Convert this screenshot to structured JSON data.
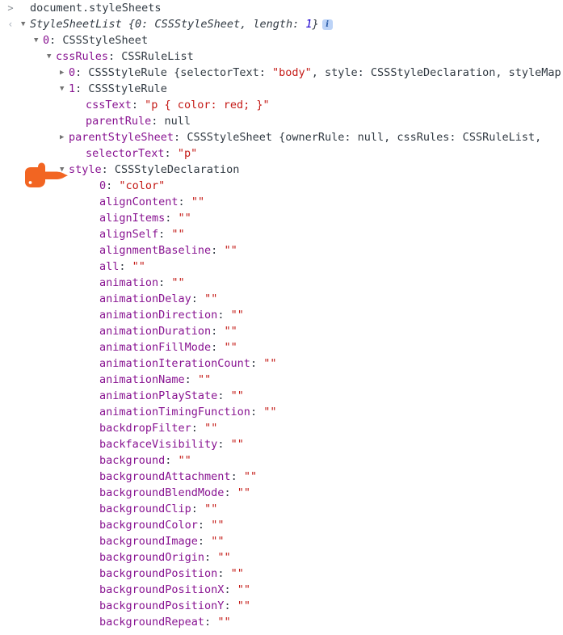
{
  "console": {
    "prompt_glyph": ">",
    "output_glyph": "‹",
    "input_expression": "document.styleSheets",
    "info_badge_label": "i",
    "colors": {
      "property": "#881391",
      "string": "#c41a16",
      "number": "#1c00cf",
      "text": "#303942",
      "triangle": "#737373",
      "info_badge_bg": "#bcd3f7",
      "pointer_hand": "#f26522",
      "background": "#ffffff"
    },
    "lines": [
      {
        "id": "input",
        "gutter": "prompt",
        "indent": "i0",
        "triangle": "none",
        "segments": [
          {
            "class": "cmd",
            "text": "document.styleSheets"
          }
        ]
      },
      {
        "id": "result-root",
        "gutter": "output",
        "indent": "i0",
        "triangle": "expanded",
        "segments": [
          {
            "class": "tok-obj",
            "text": "StyleSheetList"
          },
          {
            "class": "tok-italic tok-plain",
            "text": " {0: CSSStyleSheet, length: "
          },
          {
            "class": "tok-number tok-italic",
            "text": "1"
          },
          {
            "class": "tok-italic tok-plain",
            "text": "}"
          }
        ],
        "badge": true
      },
      {
        "id": "sheet-0",
        "gutter": "",
        "indent": "i1",
        "triangle": "expanded",
        "segments": [
          {
            "class": "tok-index",
            "text": "0"
          },
          {
            "class": "tok-punct",
            "text": ": "
          },
          {
            "class": "tok-ctor",
            "text": "CSSStyleSheet"
          }
        ]
      },
      {
        "id": "cssRules",
        "gutter": "",
        "indent": "i2",
        "triangle": "expanded",
        "segments": [
          {
            "class": "tok-prop",
            "text": "cssRules"
          },
          {
            "class": "tok-punct",
            "text": ": "
          },
          {
            "class": "tok-ctor",
            "text": "CSSRuleList"
          }
        ]
      },
      {
        "id": "rule-0",
        "gutter": "",
        "indent": "i3",
        "triangle": "collapsed",
        "segments": [
          {
            "class": "tok-index",
            "text": "0"
          },
          {
            "class": "tok-punct",
            "text": ": "
          },
          {
            "class": "tok-ctor",
            "text": "CSSStyleRule"
          },
          {
            "class": "tok-plain",
            "text": " {selectorText: "
          },
          {
            "class": "tok-string",
            "text": "\"body\""
          },
          {
            "class": "tok-plain",
            "text": ", style: CSSStyleDeclaration, styleMap"
          }
        ]
      },
      {
        "id": "rule-1",
        "gutter": "",
        "indent": "i3",
        "triangle": "expanded",
        "segments": [
          {
            "class": "tok-index",
            "text": "1"
          },
          {
            "class": "tok-punct",
            "text": ": "
          },
          {
            "class": "tok-ctor",
            "text": "CSSStyleRule"
          }
        ]
      },
      {
        "id": "cssText",
        "gutter": "",
        "indent": "i4",
        "triangle": "none",
        "segments": [
          {
            "class": "tok-prop",
            "text": "cssText"
          },
          {
            "class": "tok-punct",
            "text": ": "
          },
          {
            "class": "tok-string",
            "text": "\"p { color: red; }\""
          }
        ]
      },
      {
        "id": "parentRule",
        "gutter": "",
        "indent": "i4",
        "triangle": "none",
        "segments": [
          {
            "class": "tok-prop",
            "text": "parentRule"
          },
          {
            "class": "tok-punct",
            "text": ": "
          },
          {
            "class": "tok-plain",
            "text": "null"
          }
        ]
      },
      {
        "id": "parentStyleSheet",
        "gutter": "",
        "indent": "i3",
        "triangle": "collapsed",
        "segments": [
          {
            "class": "tok-prop",
            "text": "parentStyleSheet"
          },
          {
            "class": "tok-punct",
            "text": ": "
          },
          {
            "class": "tok-ctor",
            "text": "CSSStyleSheet"
          },
          {
            "class": "tok-plain",
            "text": " {ownerRule: null, cssRules: CSSRuleList,"
          }
        ]
      },
      {
        "id": "selectorText",
        "gutter": "",
        "indent": "i4",
        "triangle": "none",
        "segments": [
          {
            "class": "tok-prop",
            "text": "selectorText"
          },
          {
            "class": "tok-punct",
            "text": ": "
          },
          {
            "class": "tok-string",
            "text": "\"p\""
          }
        ]
      },
      {
        "id": "style",
        "gutter": "",
        "indent": "i3",
        "triangle": "expanded",
        "segments": [
          {
            "class": "tok-prop",
            "text": "style"
          },
          {
            "class": "tok-punct",
            "text": ": "
          },
          {
            "class": "tok-ctor",
            "text": "CSSStyleDeclaration"
          }
        ],
        "pointed": true
      },
      {
        "id": "style-0",
        "gutter": "",
        "indent": "i5",
        "triangle": "none",
        "segments": [
          {
            "class": "tok-index",
            "text": "0"
          },
          {
            "class": "tok-punct",
            "text": ": "
          },
          {
            "class": "tok-string",
            "text": "\"color\""
          }
        ]
      },
      {
        "id": "alignContent",
        "gutter": "",
        "indent": "i5",
        "triangle": "none",
        "segments": [
          {
            "class": "tok-prop",
            "text": "alignContent"
          },
          {
            "class": "tok-punct",
            "text": ": "
          },
          {
            "class": "tok-string",
            "text": "\"\""
          }
        ]
      },
      {
        "id": "alignItems",
        "gutter": "",
        "indent": "i5",
        "triangle": "none",
        "segments": [
          {
            "class": "tok-prop",
            "text": "alignItems"
          },
          {
            "class": "tok-punct",
            "text": ": "
          },
          {
            "class": "tok-string",
            "text": "\"\""
          }
        ]
      },
      {
        "id": "alignSelf",
        "gutter": "",
        "indent": "i5",
        "triangle": "none",
        "segments": [
          {
            "class": "tok-prop",
            "text": "alignSelf"
          },
          {
            "class": "tok-punct",
            "text": ": "
          },
          {
            "class": "tok-string",
            "text": "\"\""
          }
        ]
      },
      {
        "id": "alignmentBaseline",
        "gutter": "",
        "indent": "i5",
        "triangle": "none",
        "segments": [
          {
            "class": "tok-prop",
            "text": "alignmentBaseline"
          },
          {
            "class": "tok-punct",
            "text": ": "
          },
          {
            "class": "tok-string",
            "text": "\"\""
          }
        ]
      },
      {
        "id": "all",
        "gutter": "",
        "indent": "i5",
        "triangle": "none",
        "segments": [
          {
            "class": "tok-prop",
            "text": "all"
          },
          {
            "class": "tok-punct",
            "text": ": "
          },
          {
            "class": "tok-string",
            "text": "\"\""
          }
        ]
      },
      {
        "id": "animation",
        "gutter": "",
        "indent": "i5",
        "triangle": "none",
        "segments": [
          {
            "class": "tok-prop",
            "text": "animation"
          },
          {
            "class": "tok-punct",
            "text": ": "
          },
          {
            "class": "tok-string",
            "text": "\"\""
          }
        ]
      },
      {
        "id": "animationDelay",
        "gutter": "",
        "indent": "i5",
        "triangle": "none",
        "segments": [
          {
            "class": "tok-prop",
            "text": "animationDelay"
          },
          {
            "class": "tok-punct",
            "text": ": "
          },
          {
            "class": "tok-string",
            "text": "\"\""
          }
        ]
      },
      {
        "id": "animationDirection",
        "gutter": "",
        "indent": "i5",
        "triangle": "none",
        "segments": [
          {
            "class": "tok-prop",
            "text": "animationDirection"
          },
          {
            "class": "tok-punct",
            "text": ": "
          },
          {
            "class": "tok-string",
            "text": "\"\""
          }
        ]
      },
      {
        "id": "animationDuration",
        "gutter": "",
        "indent": "i5",
        "triangle": "none",
        "segments": [
          {
            "class": "tok-prop",
            "text": "animationDuration"
          },
          {
            "class": "tok-punct",
            "text": ": "
          },
          {
            "class": "tok-string",
            "text": "\"\""
          }
        ]
      },
      {
        "id": "animationFillMode",
        "gutter": "",
        "indent": "i5",
        "triangle": "none",
        "segments": [
          {
            "class": "tok-prop",
            "text": "animationFillMode"
          },
          {
            "class": "tok-punct",
            "text": ": "
          },
          {
            "class": "tok-string",
            "text": "\"\""
          }
        ]
      },
      {
        "id": "animationIterationCount",
        "gutter": "",
        "indent": "i5",
        "triangle": "none",
        "segments": [
          {
            "class": "tok-prop",
            "text": "animationIterationCount"
          },
          {
            "class": "tok-punct",
            "text": ": "
          },
          {
            "class": "tok-string",
            "text": "\"\""
          }
        ]
      },
      {
        "id": "animationName",
        "gutter": "",
        "indent": "i5",
        "triangle": "none",
        "segments": [
          {
            "class": "tok-prop",
            "text": "animationName"
          },
          {
            "class": "tok-punct",
            "text": ": "
          },
          {
            "class": "tok-string",
            "text": "\"\""
          }
        ]
      },
      {
        "id": "animationPlayState",
        "gutter": "",
        "indent": "i5",
        "triangle": "none",
        "segments": [
          {
            "class": "tok-prop",
            "text": "animationPlayState"
          },
          {
            "class": "tok-punct",
            "text": ": "
          },
          {
            "class": "tok-string",
            "text": "\"\""
          }
        ]
      },
      {
        "id": "animationTimingFunction",
        "gutter": "",
        "indent": "i5",
        "triangle": "none",
        "segments": [
          {
            "class": "tok-prop",
            "text": "animationTimingFunction"
          },
          {
            "class": "tok-punct",
            "text": ": "
          },
          {
            "class": "tok-string",
            "text": "\"\""
          }
        ]
      },
      {
        "id": "backdropFilter",
        "gutter": "",
        "indent": "i5",
        "triangle": "none",
        "segments": [
          {
            "class": "tok-prop",
            "text": "backdropFilter"
          },
          {
            "class": "tok-punct",
            "text": ": "
          },
          {
            "class": "tok-string",
            "text": "\"\""
          }
        ]
      },
      {
        "id": "backfaceVisibility",
        "gutter": "",
        "indent": "i5",
        "triangle": "none",
        "segments": [
          {
            "class": "tok-prop",
            "text": "backfaceVisibility"
          },
          {
            "class": "tok-punct",
            "text": ": "
          },
          {
            "class": "tok-string",
            "text": "\"\""
          }
        ]
      },
      {
        "id": "background",
        "gutter": "",
        "indent": "i5",
        "triangle": "none",
        "segments": [
          {
            "class": "tok-prop",
            "text": "background"
          },
          {
            "class": "tok-punct",
            "text": ": "
          },
          {
            "class": "tok-string",
            "text": "\"\""
          }
        ]
      },
      {
        "id": "backgroundAttachment",
        "gutter": "",
        "indent": "i5",
        "triangle": "none",
        "segments": [
          {
            "class": "tok-prop",
            "text": "backgroundAttachment"
          },
          {
            "class": "tok-punct",
            "text": ": "
          },
          {
            "class": "tok-string",
            "text": "\"\""
          }
        ]
      },
      {
        "id": "backgroundBlendMode",
        "gutter": "",
        "indent": "i5",
        "triangle": "none",
        "segments": [
          {
            "class": "tok-prop",
            "text": "backgroundBlendMode"
          },
          {
            "class": "tok-punct",
            "text": ": "
          },
          {
            "class": "tok-string",
            "text": "\"\""
          }
        ]
      },
      {
        "id": "backgroundClip",
        "gutter": "",
        "indent": "i5",
        "triangle": "none",
        "segments": [
          {
            "class": "tok-prop",
            "text": "backgroundClip"
          },
          {
            "class": "tok-punct",
            "text": ": "
          },
          {
            "class": "tok-string",
            "text": "\"\""
          }
        ]
      },
      {
        "id": "backgroundColor",
        "gutter": "",
        "indent": "i5",
        "triangle": "none",
        "segments": [
          {
            "class": "tok-prop",
            "text": "backgroundColor"
          },
          {
            "class": "tok-punct",
            "text": ": "
          },
          {
            "class": "tok-string",
            "text": "\"\""
          }
        ]
      },
      {
        "id": "backgroundImage",
        "gutter": "",
        "indent": "i5",
        "triangle": "none",
        "segments": [
          {
            "class": "tok-prop",
            "text": "backgroundImage"
          },
          {
            "class": "tok-punct",
            "text": ": "
          },
          {
            "class": "tok-string",
            "text": "\"\""
          }
        ]
      },
      {
        "id": "backgroundOrigin",
        "gutter": "",
        "indent": "i5",
        "triangle": "none",
        "segments": [
          {
            "class": "tok-prop",
            "text": "backgroundOrigin"
          },
          {
            "class": "tok-punct",
            "text": ": "
          },
          {
            "class": "tok-string",
            "text": "\"\""
          }
        ]
      },
      {
        "id": "backgroundPosition",
        "gutter": "",
        "indent": "i5",
        "triangle": "none",
        "segments": [
          {
            "class": "tok-prop",
            "text": "backgroundPosition"
          },
          {
            "class": "tok-punct",
            "text": ": "
          },
          {
            "class": "tok-string",
            "text": "\"\""
          }
        ]
      },
      {
        "id": "backgroundPositionX",
        "gutter": "",
        "indent": "i5",
        "triangle": "none",
        "segments": [
          {
            "class": "tok-prop",
            "text": "backgroundPositionX"
          },
          {
            "class": "tok-punct",
            "text": ": "
          },
          {
            "class": "tok-string",
            "text": "\"\""
          }
        ]
      },
      {
        "id": "backgroundPositionY",
        "gutter": "",
        "indent": "i5",
        "triangle": "none",
        "segments": [
          {
            "class": "tok-prop",
            "text": "backgroundPositionY"
          },
          {
            "class": "tok-punct",
            "text": ": "
          },
          {
            "class": "tok-string",
            "text": "\"\""
          }
        ]
      },
      {
        "id": "backgroundRepeat",
        "gutter": "",
        "indent": "i5",
        "triangle": "none",
        "segments": [
          {
            "class": "tok-prop",
            "text": "backgroundRepeat"
          },
          {
            "class": "tok-punct",
            "text": ": "
          },
          {
            "class": "tok-string",
            "text": "\"\""
          }
        ]
      }
    ]
  }
}
